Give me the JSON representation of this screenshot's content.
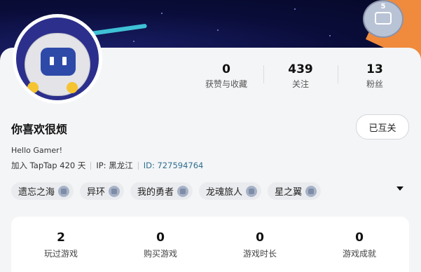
{
  "header": {
    "level_badge": {
      "level": "5",
      "icon": "gamepad-icon"
    }
  },
  "profile": {
    "nickname": "你喜欢很烦",
    "bio": "Hello Gamer!",
    "joined": "加入 TapTap 420 天",
    "ip": "IP: 黑龙江",
    "id": "ID: 727594764",
    "mutual_button": "已互关"
  },
  "stats": [
    {
      "value": "0",
      "label": "获赞与收藏"
    },
    {
      "value": "439",
      "label": "关注"
    },
    {
      "value": "13",
      "label": "粉丝"
    }
  ],
  "games": [
    {
      "name": "遗忘之海"
    },
    {
      "name": "异环"
    },
    {
      "name": "我的勇者"
    },
    {
      "name": "龙魂旅人"
    },
    {
      "name": "星之翼"
    }
  ],
  "game_stats": [
    {
      "value": "2",
      "label": "玩过游戏"
    },
    {
      "value": "0",
      "label": "购买游戏"
    },
    {
      "value": "0",
      "label": "游戏时长"
    },
    {
      "value": "0",
      "label": "游戏成就"
    }
  ],
  "colors": {
    "banner": "#0a0d3a",
    "accent_id": "#2e6f8f",
    "card_bg": "#f4f5f7"
  }
}
